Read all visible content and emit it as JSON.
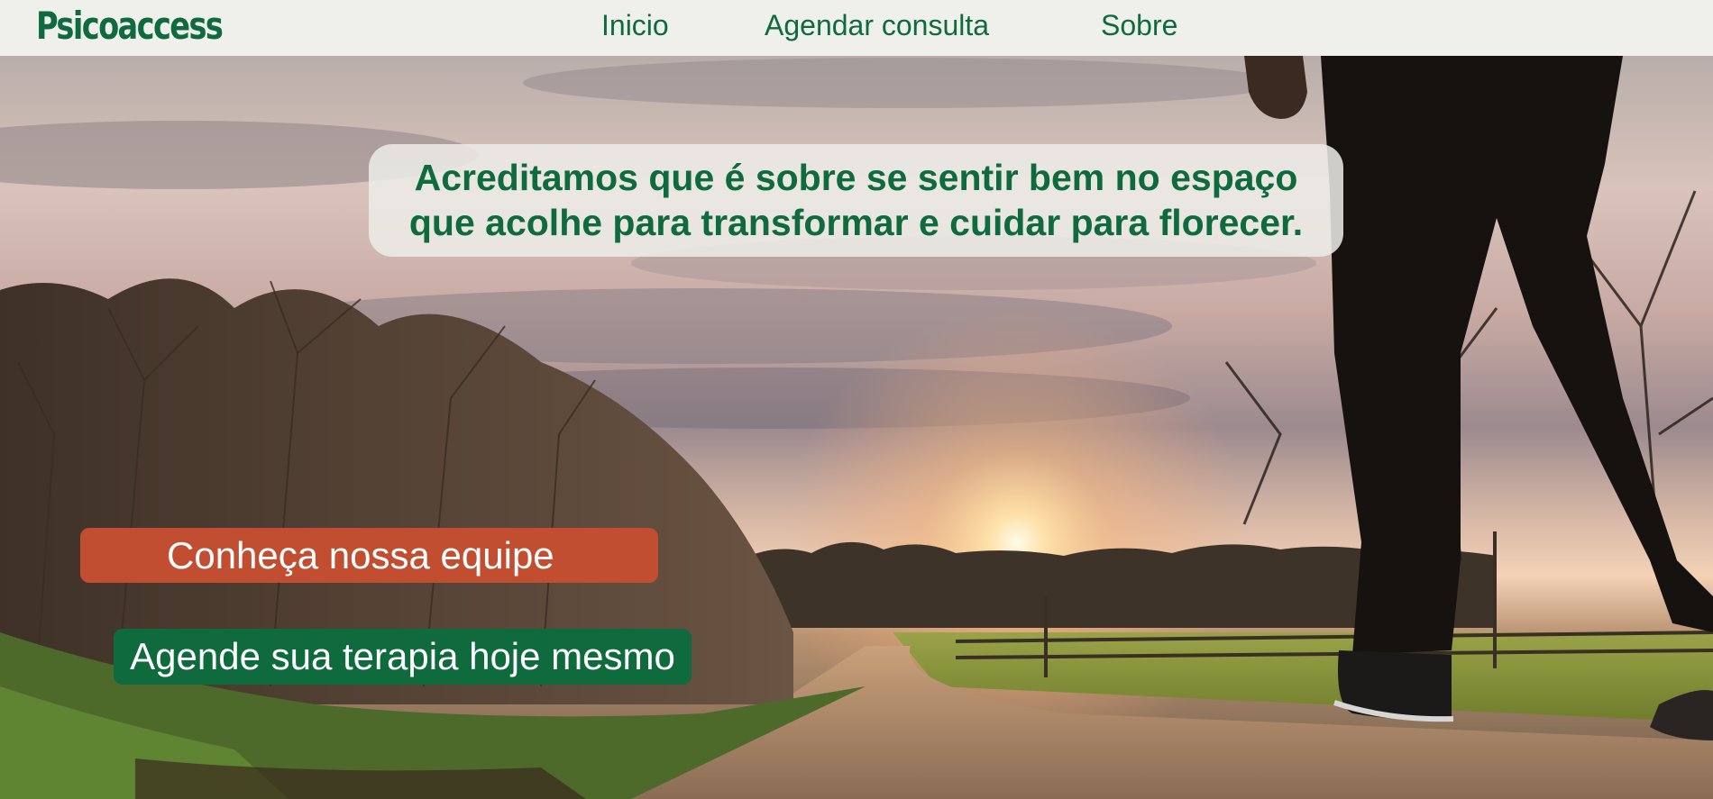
{
  "header": {
    "logo_text": "Psicoaccess",
    "nav": [
      {
        "label": "Inicio"
      },
      {
        "label": "Agendar consulta"
      },
      {
        "label": "Sobre"
      }
    ]
  },
  "hero": {
    "image_icon": "sunset-path-photo",
    "tagline": {
      "line1": "Acreditamos que é sobre se sentir bem no espaço",
      "line2": "que acolhe para transformar e cuidar para florecer."
    },
    "buttons": {
      "team_label": "Conheça nossa equipe",
      "book_label": "Agende sua terapia hoje mesmo"
    }
  },
  "colors": {
    "brand_green": "#0f6b3d",
    "accent_orange": "#c14e31",
    "header_bg": "#eff0ec"
  }
}
